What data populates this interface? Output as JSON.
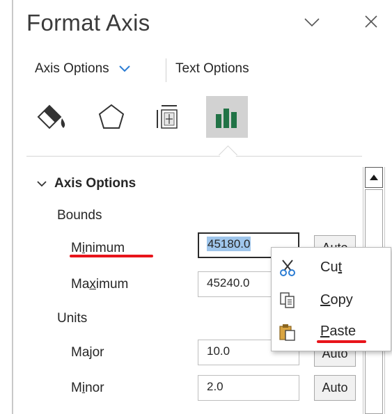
{
  "panel": {
    "title": "Format Axis"
  },
  "tabs": {
    "axis_options": "Axis Options",
    "text_options": "Text Options"
  },
  "icon_tabs": [
    "fill-line-icon",
    "effects-icon",
    "size-properties-icon",
    "axis-options-icon"
  ],
  "section": {
    "title": "Axis Options",
    "bounds_label": "Bounds",
    "minimum": {
      "label_pre": "M",
      "label_acc": "i",
      "label_post": "nimum",
      "value": "45180.0"
    },
    "maximum": {
      "label_pre": "Ma",
      "label_acc": "x",
      "label_post": "imum",
      "value": "45240.0"
    },
    "units_label": "Units",
    "major": {
      "label": "Major",
      "value": "10.0"
    },
    "minor": {
      "label_pre": "M",
      "label_acc": "i",
      "label_post": "nor",
      "value": "2.0"
    },
    "auto_label": "Auto"
  },
  "context_menu": {
    "cut": {
      "pre": "Cu",
      "acc": "t",
      "post": ""
    },
    "copy": {
      "pre": "",
      "acc": "C",
      "post": "opy"
    },
    "paste": {
      "pre": "",
      "acc": "P",
      "post": "aste"
    }
  },
  "colors": {
    "annotation_red": "#e8141b",
    "selection_blue": "#9fc6ec",
    "selected_icon_bg": "#d2d2d2",
    "chart_icon_green": "#217346"
  }
}
